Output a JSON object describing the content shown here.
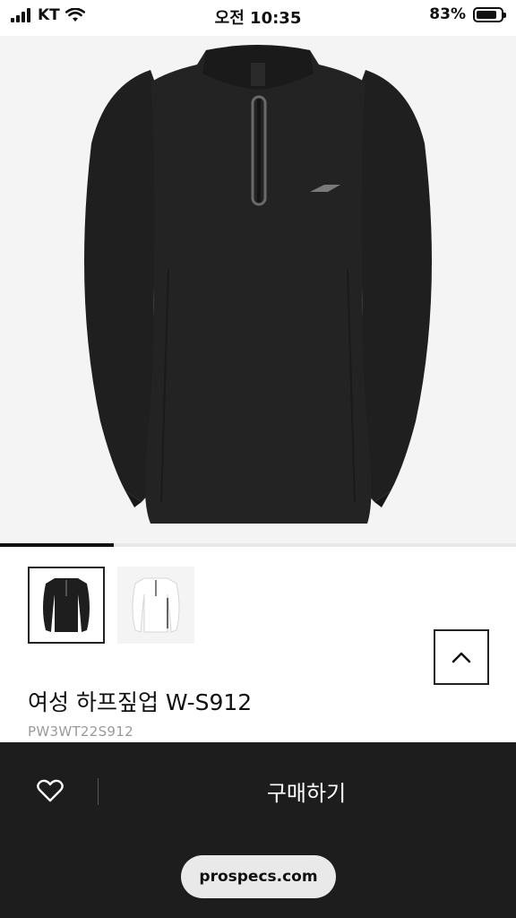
{
  "status_bar": {
    "carrier": "KT",
    "time": "오전 10:35",
    "battery": "83%",
    "battery_level": 0.83
  },
  "gallery": {
    "progress": 0.22,
    "thumbnails": [
      {
        "name": "thumbnail-black",
        "color": "#1e1e1e",
        "active": true
      },
      {
        "name": "thumbnail-white",
        "color": "#ffffff",
        "active": false
      }
    ]
  },
  "icons": {
    "signal": "signal-icon",
    "wifi": "wifi-icon",
    "battery": "battery-icon",
    "scroll_top": "chevron-up-icon",
    "wishlist": "heart-icon"
  },
  "product": {
    "title": "여성 하프짚업 W-S912",
    "code": "PW3WT22S912"
  },
  "actions": {
    "buy_label": "구매하기"
  },
  "browser": {
    "url": "prospecs.com"
  }
}
